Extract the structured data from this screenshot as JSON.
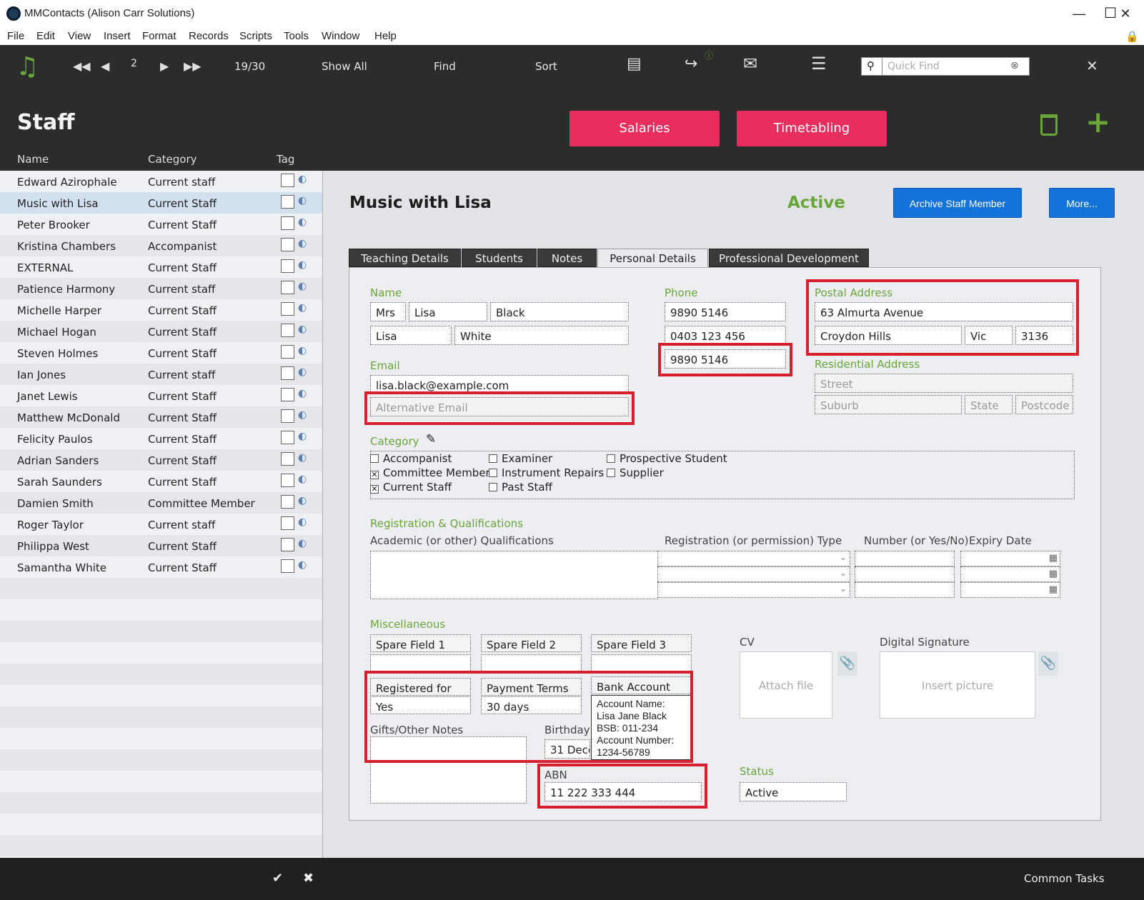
{
  "window": {
    "title": "MMContacts (Alison Carr Solutions)"
  },
  "menu": [
    "File",
    "Edit",
    "View",
    "Insert",
    "Format",
    "Records",
    "Scripts",
    "Tools",
    "Window",
    "Help"
  ],
  "toolbar": {
    "record_index": "2",
    "record_count": "19/30",
    "show_all": "Show All",
    "find": "Find",
    "sort": "Sort",
    "quick_find_placeholder": "Quick Find"
  },
  "header": {
    "title": "Staff",
    "salaries": "Salaries",
    "timetabling": "Timetabling"
  },
  "list": {
    "columns": [
      "Name",
      "Category",
      "Tag"
    ],
    "rows": [
      {
        "name": "Edward Azirophale",
        "category": "Current staff"
      },
      {
        "name": "Music with Lisa",
        "category": "Current Staff"
      },
      {
        "name": "Peter Brooker",
        "category": "Current Staff"
      },
      {
        "name": "Kristina Chambers",
        "category": "Accompanist"
      },
      {
        "name": " EXTERNAL",
        "category": "Current Staff"
      },
      {
        "name": "Patience Harmony",
        "category": "Current staff"
      },
      {
        "name": "Michelle Harper",
        "category": "Current Staff"
      },
      {
        "name": "Michael Hogan",
        "category": "Current Staff"
      },
      {
        "name": "Steven Holmes",
        "category": "Current Staff"
      },
      {
        "name": "Ian Jones",
        "category": "Current staff"
      },
      {
        "name": "Janet Lewis",
        "category": "Current Staff"
      },
      {
        "name": "Matthew McDonald",
        "category": "Current Staff"
      },
      {
        "name": "Felicity Paulos",
        "category": "Current Staff"
      },
      {
        "name": "Adrian Sanders",
        "category": "Current Staff"
      },
      {
        "name": "Sarah Saunders",
        "category": "Current Staff"
      },
      {
        "name": "Damien Smith",
        "category": "Committee Member"
      },
      {
        "name": "Roger Taylor",
        "category": "Current staff"
      },
      {
        "name": "Philippa West",
        "category": "Current Staff"
      },
      {
        "name": "Samantha White",
        "category": "Current Staff"
      }
    ]
  },
  "record": {
    "name": "Music with Lisa",
    "status": "Active",
    "archive_button": "Archive Staff Member",
    "more_button": "More...",
    "tabs": [
      "Teaching Details",
      "Students",
      "Notes",
      "Personal Details",
      "Professional Development"
    ],
    "active_tab": "Personal Details"
  },
  "personal": {
    "name_label": "Name",
    "title": "Mrs",
    "first": "Lisa",
    "last": "Black",
    "preferred": "Lisa",
    "other_last": "White",
    "email_label": "Email",
    "email": "lisa.black@example.com",
    "alt_email_placeholder": "Alternative Email",
    "phone_label": "Phone",
    "phone1": "9890 5146",
    "phone2": "0403 123 456",
    "phone3": "9890 5146",
    "postal_label": "Postal Address",
    "postal_street": "63 Almurta Avenue",
    "postal_suburb": "Croydon Hills",
    "postal_state": "Vic",
    "postal_postcode": "3136",
    "res_label": "Residential Address",
    "res_street_ph": "Street",
    "res_suburb_ph": "Suburb",
    "res_state_ph": "State",
    "res_postcode_ph": "Postcode",
    "category_label": "Category",
    "categories": [
      {
        "label": "Accompanist",
        "checked": false
      },
      {
        "label": "Committee Member",
        "checked": true
      },
      {
        "label": "Current Staff",
        "checked": true
      },
      {
        "label": "Examiner",
        "checked": false
      },
      {
        "label": "Instrument Repairs",
        "checked": false
      },
      {
        "label": "Past Staff",
        "checked": false
      },
      {
        "label": "Prospective Student",
        "checked": false
      },
      {
        "label": "Supplier",
        "checked": false
      }
    ],
    "reg_label": "Registration & Qualifications",
    "qual_label": "Academic (or other) Qualifications",
    "reg_type_label": "Registration (or permission) Type",
    "number_label": "Number (or Yes/No)",
    "expiry_label": "Expiry Date",
    "misc_label": "Miscellaneous",
    "spare1": "Spare Field 1",
    "spare2": "Spare Field 2",
    "spare3": "Spare Field 3",
    "registered_for": "Registered for",
    "registered_value": "Yes",
    "payment_terms": "Payment Terms",
    "payment_value": "30 days",
    "bank_account": "Bank Account",
    "bank_value": "Account Name: Lisa Jane Black\nBSB: 011-234\nAccount Number: 1234-56789",
    "gifts_label": "Gifts/Other Notes",
    "birthday_label": "Birthday",
    "birthday_value": "31 Dece",
    "abn_label": "ABN",
    "abn_value": "11 222 333 444",
    "cv_label": "CV",
    "attach_file": "Attach file",
    "sig_label": "Digital Signature",
    "insert_picture": "Insert picture",
    "status_label": "Status",
    "status_value": "Active"
  },
  "footer": {
    "common_tasks": "Common Tasks"
  },
  "colors": {
    "accent_green": "#6aa53a",
    "pink": "#ea2d5f",
    "blue": "#1473d8",
    "highlight_red": "#d81f2e"
  }
}
